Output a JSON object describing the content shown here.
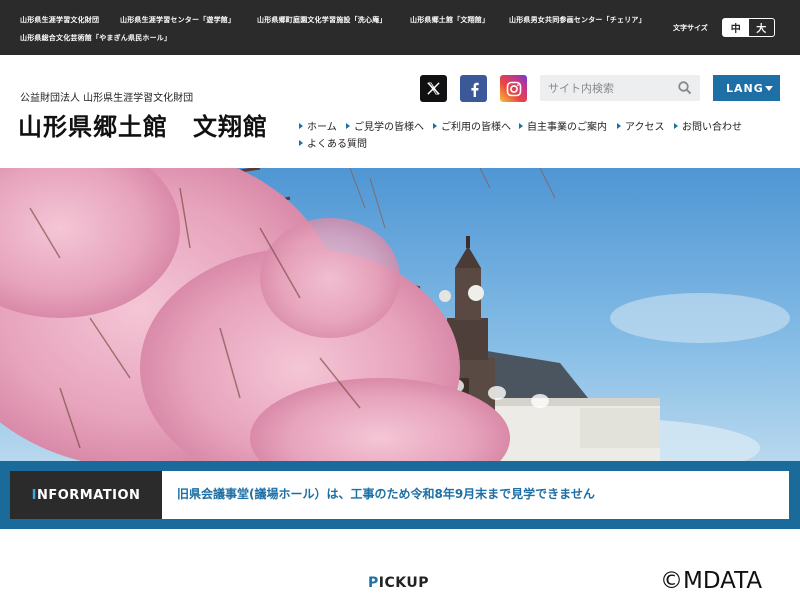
{
  "topbar": {
    "links": [
      "山形県生涯学習文化財団",
      "山形県生涯学習センター「遊学館」",
      "山形県郷町庭園文化学習施設「洗心庵」",
      "山形県郷土館「文翔館」",
      "山形県男女共同参画センター「チェリア」",
      "山形県総合文化芸術館「やまぎん県民ホール」"
    ],
    "font_size_label": "文字サイズ",
    "font_size_medium": "中",
    "font_size_large": "大"
  },
  "header": {
    "org": "公益財団法人 山形県生涯学習文化財団",
    "title": "山形県郷土館　文翔館",
    "search_placeholder": "サイト内検索",
    "lang_label": "LANG"
  },
  "nav": {
    "items": [
      "ホーム",
      "ご見学の皆様へ",
      "ご利用の皆様へ",
      "自主事業のご案内",
      "アクセス",
      "お問い合わせ",
      "よくある質問"
    ]
  },
  "info": {
    "label_initial": "I",
    "label_rest": "NFORMATION",
    "text": "旧県会議事堂(議場ホール）は、工事のため令和8年9月末まで見学できません"
  },
  "pickup": {
    "initial": "P",
    "rest": "ICKUP"
  },
  "watermark": "©MDATA",
  "colors": {
    "accent": "#1d6fa5",
    "topbar": "#2b2b2b",
    "band": "#1b6b9a"
  },
  "icons": [
    "x-icon",
    "facebook-icon",
    "instagram-icon",
    "search-icon",
    "caret-down-icon"
  ]
}
